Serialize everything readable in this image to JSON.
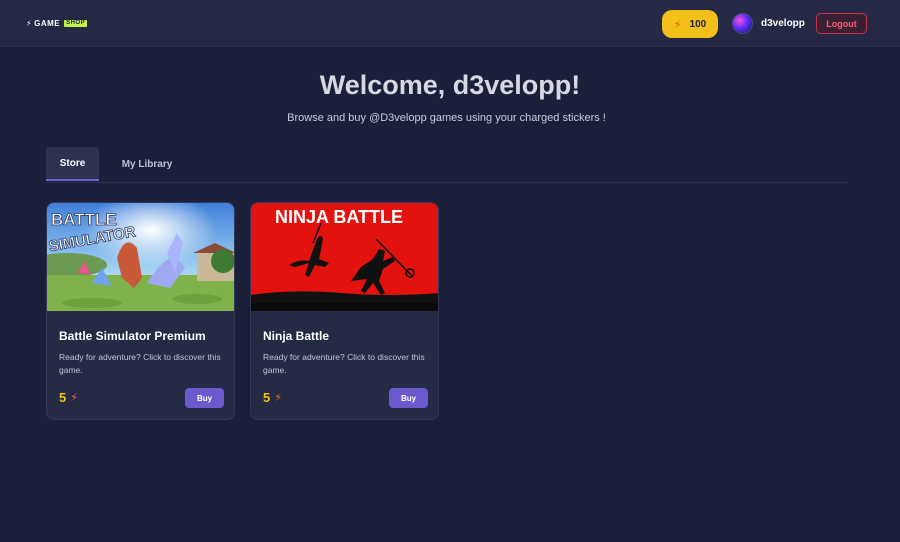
{
  "header": {
    "logo_text": "GAME",
    "logo_tag": "SHOP",
    "balance": "100",
    "balance_icon": "lightning-bolt-icon",
    "username": "d3velopp",
    "logout_label": "Logout"
  },
  "main": {
    "welcome": "Welcome, d3velopp!",
    "subtitle": "Browse and buy @D3velopp games using your charged stickers !",
    "tabs": [
      {
        "label": "Store",
        "active": true
      },
      {
        "label": "My Library",
        "active": false
      }
    ],
    "games": [
      {
        "title": "Battle Simulator Premium",
        "thumb_text": [
          "BATTLE",
          "SIMULATOR"
        ],
        "description": "Ready for adventure? Click to discover this game.",
        "price": "5",
        "buy_label": "Buy"
      },
      {
        "title": "Ninja Battle",
        "thumb_text": [
          "NINJA BATTLE"
        ],
        "description": "Ready for adventure? Click to discover this game.",
        "price": "5",
        "buy_label": "Buy"
      }
    ]
  },
  "colors": {
    "background": "#1b1f3a",
    "accent": "#6a5acd",
    "coin": "#f3c019",
    "logout": "#c5364a"
  }
}
